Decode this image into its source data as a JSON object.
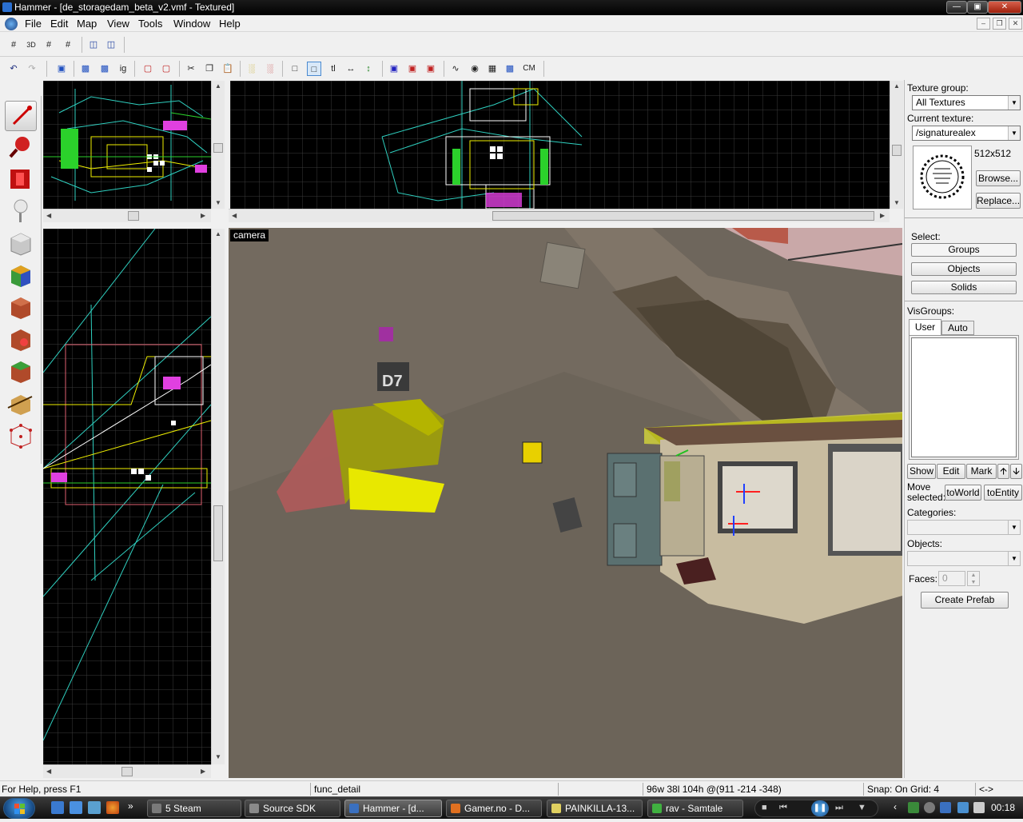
{
  "window": {
    "title": "Hammer - [de_storagedam_beta_v2.vmf - Textured]"
  },
  "menu": [
    "File",
    "Edit",
    "Map",
    "View",
    "Tools",
    "Window",
    "Help"
  ],
  "toolbar1": {
    "icons": [
      "grid-icon",
      "3d-grid-icon",
      "grid-smaller-icon",
      "grid-larger-icon",
      "group-icon",
      "ungroup-icon"
    ]
  },
  "toolbar2": {
    "labels": {
      "ig": "ig",
      "tl": "tl",
      "cm": "CM"
    }
  },
  "left_tools": [
    "selection-tool-icon",
    "magnify-tool-icon",
    "camera-tool-icon",
    "entity-tool-icon",
    "block-tool-icon",
    "texture-application-icon",
    "apply-texture-icon",
    "decal-tool-icon",
    "overlay-tool-icon",
    "clipping-tool-icon",
    "vertex-tool-icon"
  ],
  "camera": {
    "label": "camera",
    "sign": "D7"
  },
  "texture_panel": {
    "group_label": "Texture group:",
    "group_value": "All Textures",
    "current_label": "Current texture:",
    "current_value": "/signaturealex",
    "size": "512x512",
    "browse": "Browse...",
    "replace": "Replace..."
  },
  "select_panel": {
    "label": "Select:",
    "groups": "Groups",
    "objects": "Objects",
    "solids": "Solids"
  },
  "visgroups": {
    "label": "VisGroups:",
    "tabs": [
      "User",
      "Auto"
    ],
    "show": "Show",
    "edit": "Edit",
    "mark": "Mark"
  },
  "move_panel": {
    "label": "Move selected:",
    "to_world": "toWorld",
    "to_entity": "toEntity",
    "categories_label": "Categories:",
    "objects_label": "Objects:",
    "faces_label": "Faces:",
    "faces_value": "0",
    "create_prefab": "Create Prefab"
  },
  "status": {
    "help": "For Help, press F1",
    "entity": "func_detail",
    "dimensions": "96w 38l 104h @(911 -214 -348)",
    "snap": "Snap: On Grid: 4",
    "arrows": "<->"
  },
  "taskbar": {
    "tasks": [
      "5 Steam",
      "Source SDK",
      "Hammer - [d...",
      "Gamer.no - D...",
      "PAINKILLA-13...",
      "rav - Samtale"
    ],
    "clock": "00:18"
  },
  "colors": {
    "accent_green": "#2bd12b",
    "wire_cyan": "#2fd0c0",
    "wire_yellow": "#f0f000",
    "wire_magenta": "#e040e0",
    "viewport_bg": "#000000"
  }
}
